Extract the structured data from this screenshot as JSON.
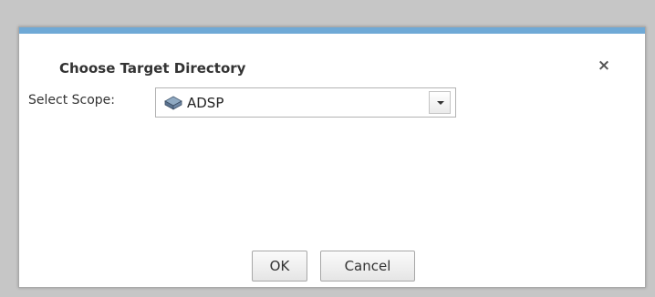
{
  "dialog": {
    "title": "Choose Target Directory",
    "close_symbol": "×",
    "scope_label": "Select Scope:",
    "scope_select": {
      "value": "ADSP",
      "icon": "directory-icon"
    },
    "buttons": {
      "ok_label": "OK",
      "cancel_label": "Cancel"
    }
  },
  "colors": {
    "accent_bar": "#6fa9d6",
    "backdrop": "#c6c6c6"
  }
}
